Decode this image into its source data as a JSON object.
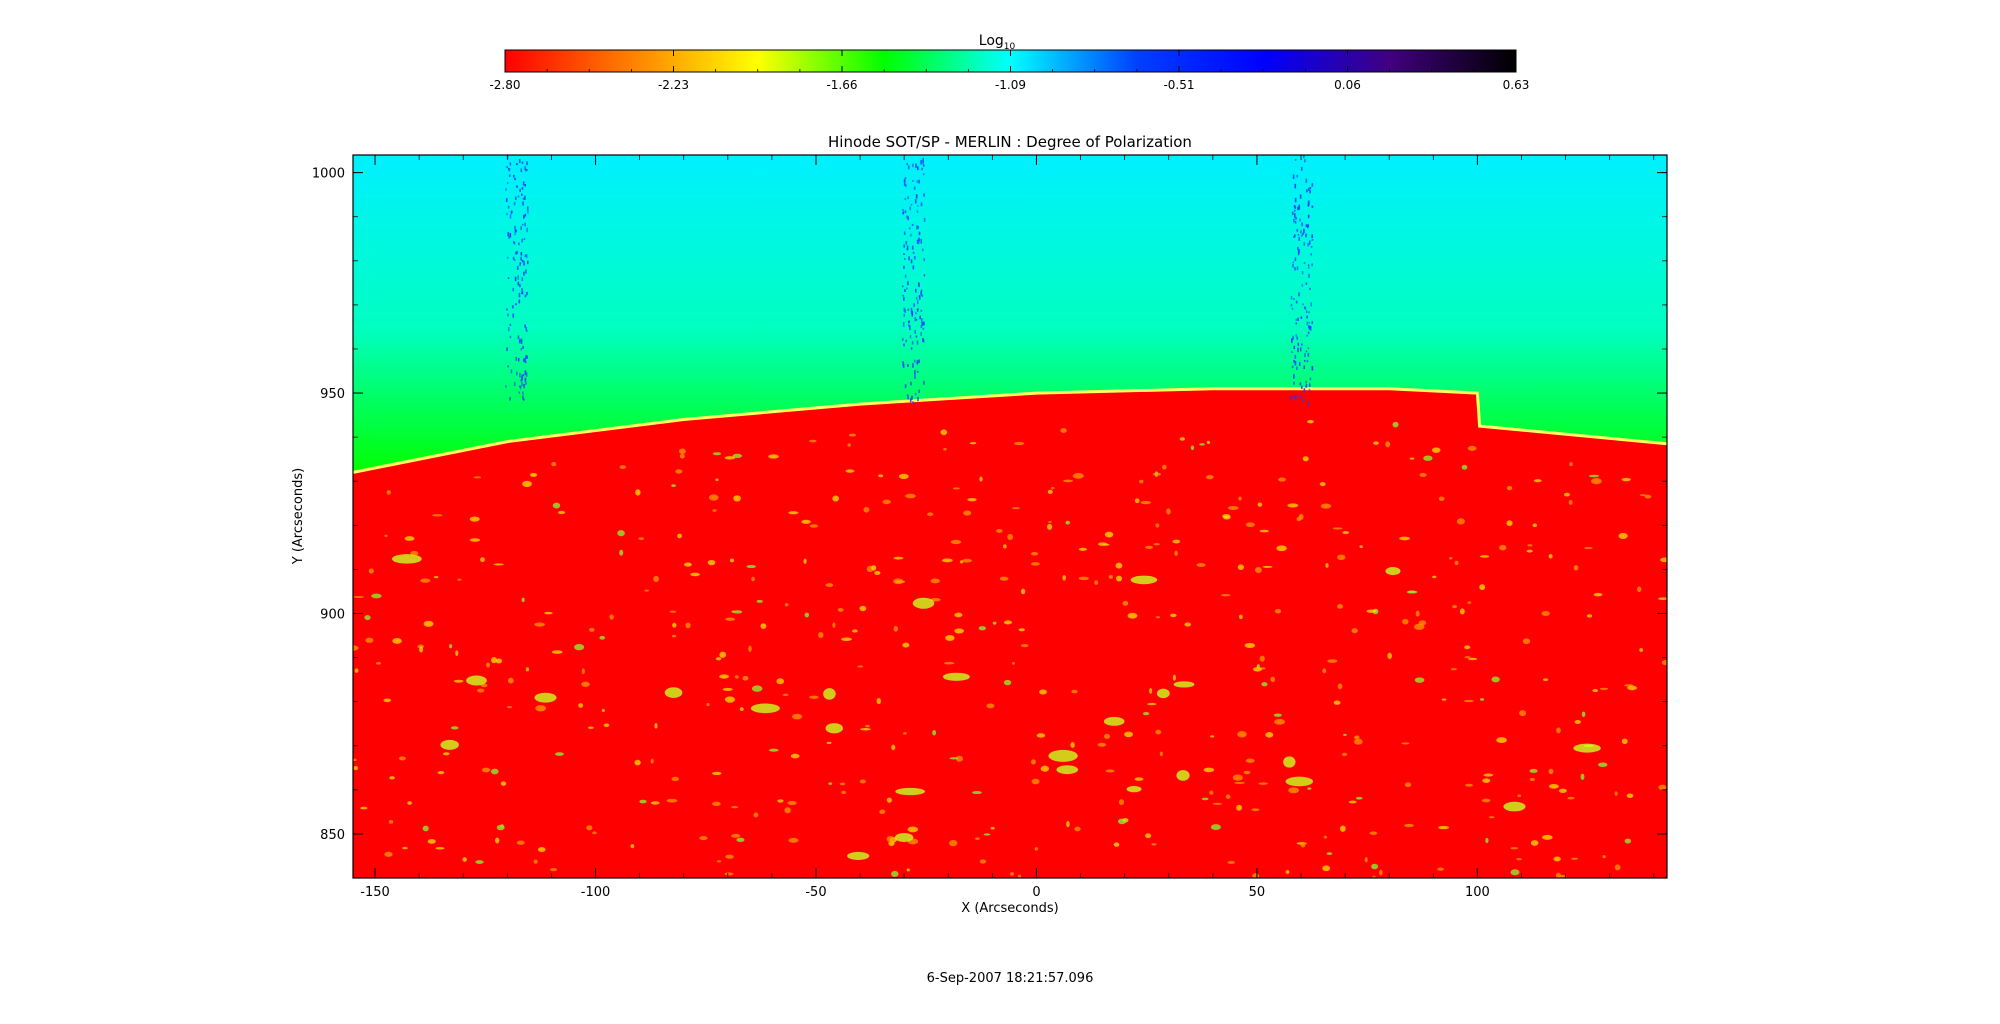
{
  "colorbar": {
    "label": "Log",
    "label_subscript": "10",
    "ticks": [
      "-2.80",
      "-2.23",
      "-1.66",
      "-1.09",
      "-0.51",
      "0.06",
      "0.63"
    ],
    "range": [
      -2.8,
      0.63
    ],
    "colors": [
      "#ff0000",
      "#ff8000",
      "#ffff00",
      "#00ff00",
      "#00ffff",
      "#0040ff",
      "#0000ff",
      "#400080",
      "#000000"
    ]
  },
  "chart_data": {
    "type": "heatmap",
    "title": "Hinode SOT/SP - MERLIN : Degree of Polarization",
    "xlabel": "X (Arcseconds)",
    "ylabel": "Y (Arcseconds)",
    "xlim": [
      -155,
      143
    ],
    "ylim": [
      840,
      1004
    ],
    "xticks": [
      -150,
      -100,
      -50,
      0,
      50,
      100
    ],
    "yticks": [
      850,
      900,
      950,
      1000
    ],
    "limb_profile_y": [
      {
        "x": -155,
        "y": 932
      },
      {
        "x": -120,
        "y": 939
      },
      {
        "x": -80,
        "y": 944
      },
      {
        "x": -40,
        "y": 947.5
      },
      {
        "x": 0,
        "y": 950
      },
      {
        "x": 40,
        "y": 951
      },
      {
        "x": 80,
        "y": 951
      },
      {
        "x": 100,
        "y": 950
      },
      {
        "x": 100.5,
        "y": 942.5
      },
      {
        "x": 143,
        "y": 938.5
      }
    ],
    "regions": {
      "off_limb_near": "#00ff00",
      "off_limb_far": "#00ffff",
      "disk": "#ff0000",
      "disk_features": "#ffff00"
    },
    "timestamp": "6-Sep-2007 18:21:57.096"
  }
}
